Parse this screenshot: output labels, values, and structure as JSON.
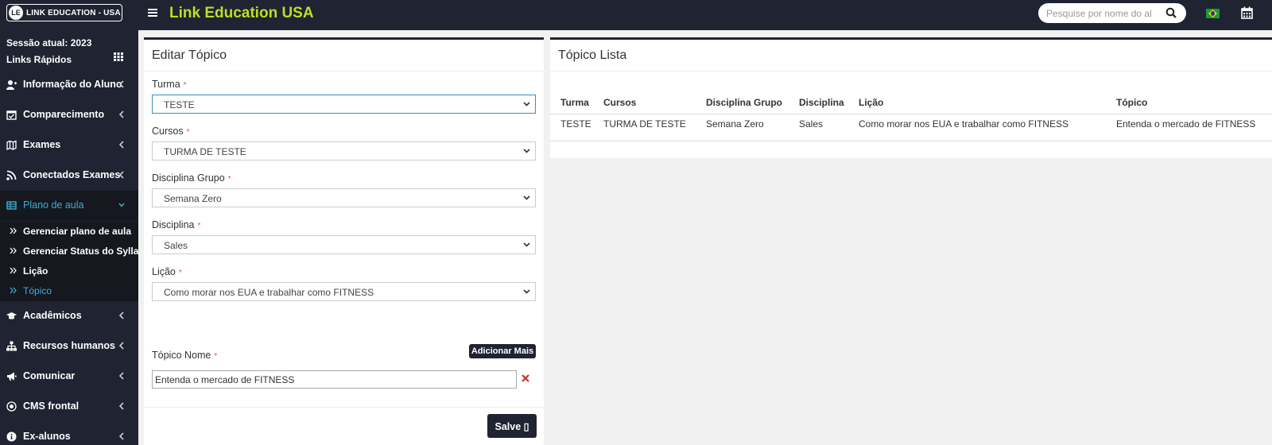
{
  "header": {
    "logo_text": "LINK EDUCATION - USA",
    "logo_mark": "LE",
    "app_title": "Link Education USA",
    "search_placeholder": "Pesquise por nome do al",
    "brand_color": "#b9e025",
    "bar_color": "#1f2332"
  },
  "sidebar": {
    "session": "Sessão atual: 2023",
    "quick_links": "Links Rápidos",
    "items": [
      {
        "label": "Informação do Aluno",
        "icon": "user-icon"
      },
      {
        "label": "Comparecimento",
        "icon": "calendar-check-icon"
      },
      {
        "label": "Exames",
        "icon": "map-icon"
      },
      {
        "label": "Conectados Exames",
        "icon": "rss-icon"
      },
      {
        "label": "Plano de aula",
        "icon": "table-icon"
      },
      {
        "label": "Acadêmicos",
        "icon": "graduation-cap-icon"
      },
      {
        "label": "Recursos humanos",
        "icon": "sitemap-icon"
      },
      {
        "label": "Comunicar",
        "icon": "bullhorn-icon"
      },
      {
        "label": "CMS frontal",
        "icon": "globe-icon"
      },
      {
        "label": "Ex-alunos",
        "icon": "info-icon"
      }
    ],
    "subitems": [
      {
        "label": "Gerenciar plano de aula"
      },
      {
        "label": "Gerenciar Status do Syllabus"
      },
      {
        "label": "Lição"
      },
      {
        "label": "Tópico"
      }
    ],
    "active_color": "#3ab0d0"
  },
  "edit_form": {
    "title": "Editar Tópico",
    "fields": [
      {
        "label": "Turma",
        "value": "TESTE"
      },
      {
        "label": "Cursos",
        "value": "TURMA DE TESTE"
      },
      {
        "label": "Disciplina Grupo",
        "value": "Semana Zero"
      },
      {
        "label": "Disciplina",
        "value": "Sales"
      },
      {
        "label": "Lição",
        "value": "Como morar nos EUA e trabalhar como FITNESS"
      }
    ],
    "required_mark": "*",
    "add_more_label": "Adicionar Mais",
    "topic_name_label": "Tópico Nome",
    "topic_name_value": "Entenda o mercado de FITNESS",
    "save_label": "Salve ▯"
  },
  "topic_list": {
    "title": "Tópico Lista",
    "columns": [
      "Turma",
      "Cursos",
      "Disciplina Grupo",
      "Disciplina",
      "Lição",
      "Tópico"
    ],
    "rows": [
      [
        "TESTE",
        "TURMA DE TESTE",
        "Semana Zero",
        "Sales",
        "Como morar nos EUA e trabalhar como FITNESS",
        "Entenda o mercado de FITNESS"
      ]
    ]
  }
}
